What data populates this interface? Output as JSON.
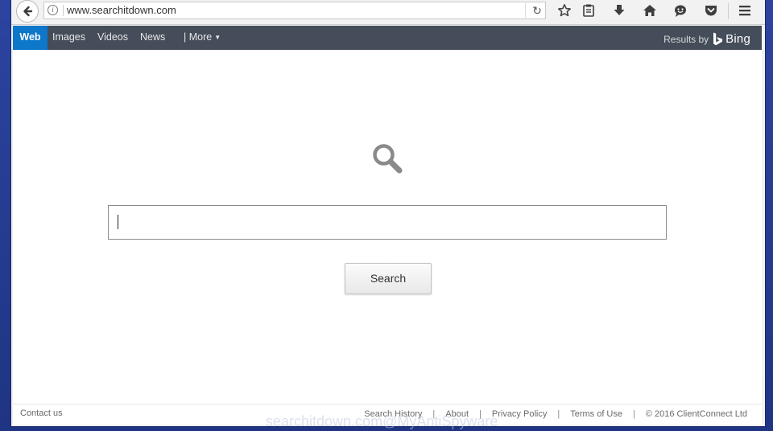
{
  "browser": {
    "url": "www.searchitdown.com"
  },
  "bing_bar": {
    "tabs": [
      "Web",
      "Images",
      "Videos",
      "News"
    ],
    "more_label": "| More",
    "results_by": "Results by",
    "bing_label": "Bing",
    "active_tab_color": "#0d77c9"
  },
  "main": {
    "search_button": "Search",
    "search_value": ""
  },
  "footer": {
    "contact": "Contact us",
    "links": [
      "Search History",
      "About",
      "Privacy Policy",
      "Terms of Use",
      "© 2016 ClientConnect Ltd"
    ],
    "separator": "|"
  },
  "watermark": "searchitdown.com@MyAntiSpyware"
}
